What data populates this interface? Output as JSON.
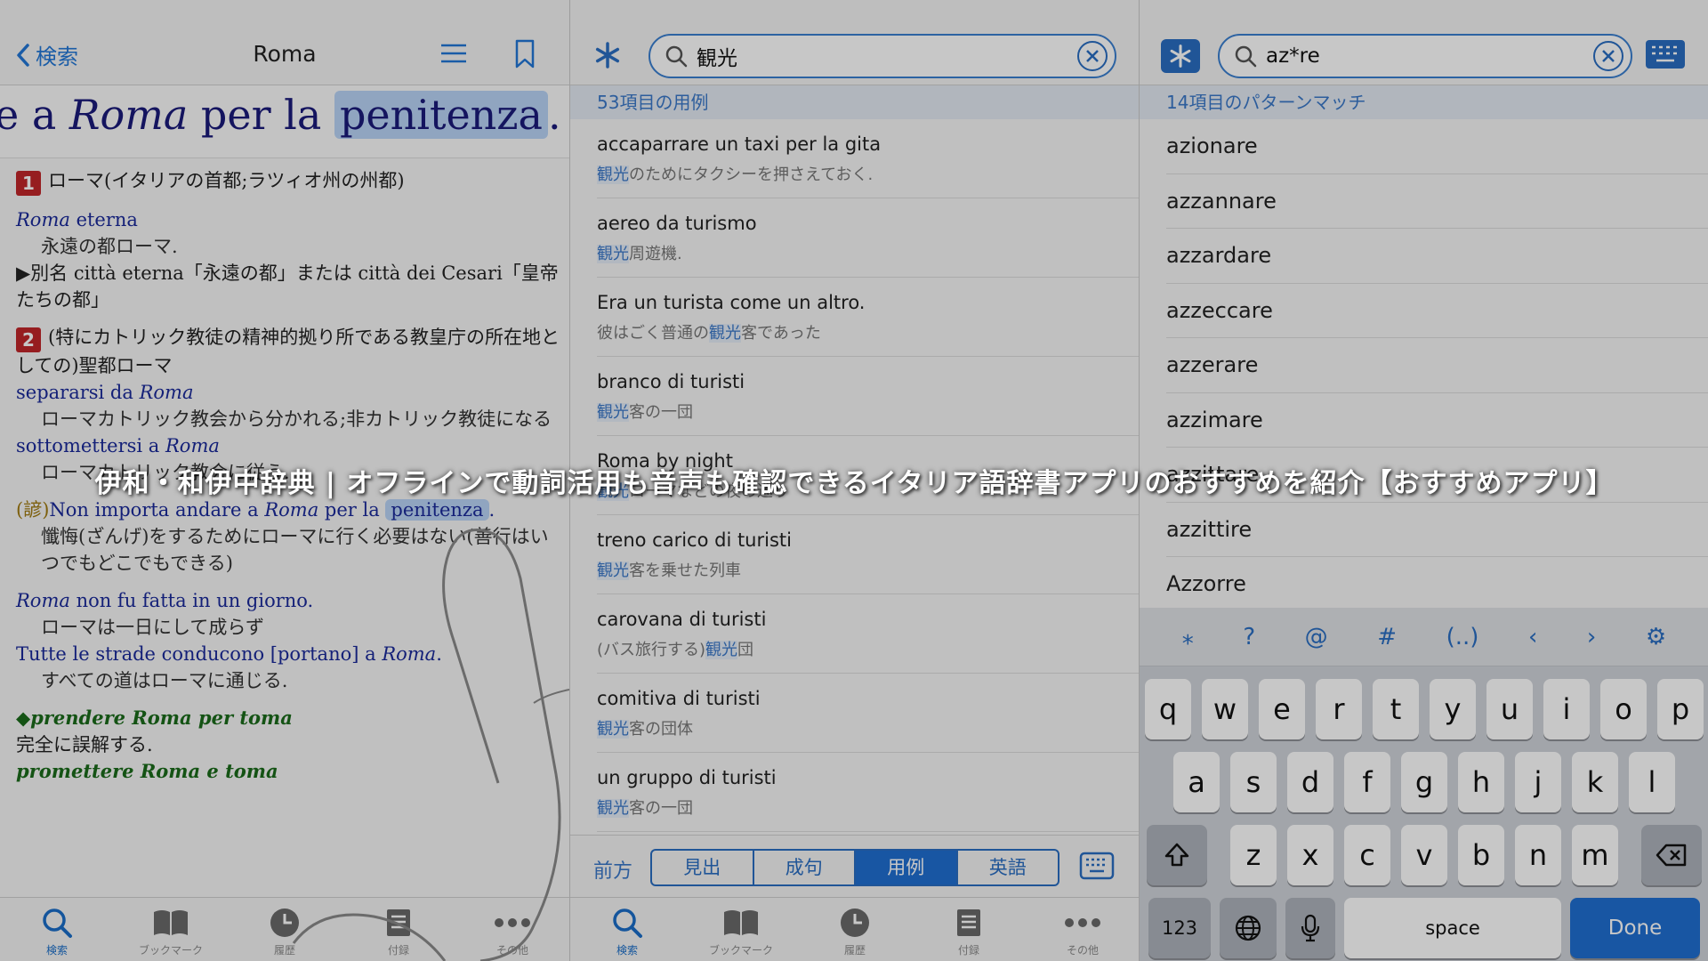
{
  "panel1": {
    "back_label": "検索",
    "title": "Roma",
    "headword_sentence": {
      "pre": "e a ",
      "roma": "Roma",
      "mid": " per la ",
      "hl": "penitenza",
      "post": "."
    },
    "sense1": {
      "num": "1",
      "def": "ローマ(イタリアの首都;ラツィオ州の州都)"
    },
    "ex1": {
      "it_roma": "Roma",
      "it_rest": " eterna",
      "ja": "永遠の都ローマ."
    },
    "note1": "▶別名 città eterna「永遠の都」または città dei Cesari「皇帝たちの都」",
    "sense2": {
      "num": "2",
      "def": "(特にカトリック教徒の精神的拠り所である教皇庁の所在地としての)聖都ローマ"
    },
    "ex2": {
      "it_pre": "separarsi da ",
      "it_roma": "Roma",
      "ja": "ローマカトリック教会から分かれる;非カトリック教徒になる"
    },
    "ex3": {
      "it_pre": "sottomettersi a ",
      "it_roma": "Roma",
      "ja": "ローマカトリック教会に従う."
    },
    "prov": {
      "tag": "(諺)",
      "pre": "Non importa andare a ",
      "roma": "Roma",
      "mid": " per la ",
      "hl": "penitenza",
      "post": ".",
      "ja": "懺悔(ざんげ)をするためにローマに行く必要はない(善行はいつでもどこでもできる)"
    },
    "ex4": {
      "it_roma": "Roma",
      "it_rest": " non fu fatta in un giorno.",
      "ja": "ローマは一日にして成らず"
    },
    "ex5": {
      "it_pre": "Tutte le strade conducono [portano] a ",
      "it_roma": "Roma",
      "it_post": ".",
      "ja": "すべての道はローマに通じる."
    },
    "idiom1": {
      "it": "◆prendere Roma per toma",
      "ja": "完全に誤解する."
    },
    "idiom2": {
      "it": "promettere Roma e toma"
    }
  },
  "tabs": [
    {
      "label": "検索"
    },
    {
      "label": "ブックマーク"
    },
    {
      "label": "履歴"
    },
    {
      "label": "付録"
    },
    {
      "label": "その他"
    }
  ],
  "panel2": {
    "search_value": "観光",
    "section_header": "53項目の用例",
    "examples": [
      {
        "it": "accaparrare un taxi per la gita",
        "k": "観光",
        "ja": "のためにタクシーを押さえておく."
      },
      {
        "it": "aereo da turismo",
        "k": "観光",
        "ja": "周遊機."
      },
      {
        "it": "Era un turista come un altro.",
        "pre": "彼はごく普通の",
        "k": "観光",
        "ja": "客であった"
      },
      {
        "it": "branco di turisti",
        "k": "観光",
        "ja": "客の一団"
      },
      {
        "it": "Roma by night",
        "k": "観光",
        "ja": "ローマなどの夜の巡り"
      },
      {
        "it": "treno carico di turisti",
        "k": "観光",
        "ja": "客を乗せた列車"
      },
      {
        "it": "carovana di turisti",
        "pre": "(バス旅行する)",
        "k": "観光",
        "ja": "団"
      },
      {
        "it": "comitiva di turisti",
        "k": "観光",
        "ja": "客の団体"
      },
      {
        "it": "un gruppo di turisti",
        "k": "観光",
        "ja": "客の一団"
      }
    ],
    "seg_prefix": "前方",
    "segments": [
      "見出",
      "成句",
      "用例",
      "英語"
    ],
    "active_segment": 2
  },
  "panel3": {
    "search_value": "az*re",
    "section_header": "14項目のパターンマッチ",
    "matches": [
      "azionare",
      "azzannare",
      "azzardare",
      "azzeccare",
      "azzerare",
      "azzimare",
      "azzittare",
      "azzittire",
      "Azzorre"
    ],
    "kb_top": [
      "⁎",
      "?",
      "@",
      "#",
      "(..)",
      "‹",
      "›",
      "⚙"
    ],
    "row1": [
      "q",
      "w",
      "e",
      "r",
      "t",
      "y",
      "u",
      "i",
      "o",
      "p"
    ],
    "row2": [
      "a",
      "s",
      "d",
      "f",
      "g",
      "h",
      "j",
      "k",
      "l"
    ],
    "row3": [
      "z",
      "x",
      "c",
      "v",
      "b",
      "n",
      "m"
    ],
    "num_key": "123",
    "space_key": "space",
    "done_key": "Done"
  },
  "caption": "伊和・和伊中辞典 | オフラインで動詞活用も音声も確認できるイタリア語辞書アプリのおすすめを紹介【おすすめアプリ】",
  "colors": {
    "accent": "#2a6ec2",
    "sense_badge": "#c0262a",
    "highlight": "#b9d4f7"
  }
}
